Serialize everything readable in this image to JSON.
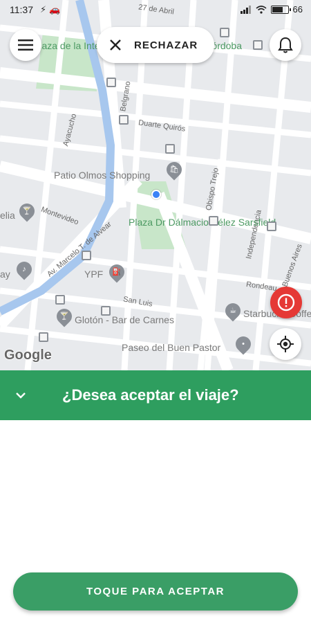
{
  "status_bar": {
    "time": "11:37",
    "battery_text": "66",
    "battery_level": 0.66
  },
  "top_controls": {
    "menu_icon": "menu-icon",
    "reject_label": "RECHAZAR",
    "reject_icon": "close-icon",
    "bell_icon": "bell-icon"
  },
  "map": {
    "labels": {
      "plaza_intendencia": "Plaza de la Intendencia de la ciudad de Córdoba",
      "abril": "27 de Abril",
      "belgrano": "Belgrano",
      "duarte_quiros": "Duarte Quirós",
      "ayacucho": "Ayacucho",
      "patio_olmos": "Patio Olmos Shopping",
      "obispo_trejo": "Obispo Trejo",
      "independencia": "Independencia",
      "montevideo": "Montevideo",
      "elia": "elia",
      "av_marcelo": "Av. Marcelo T. de Alvear",
      "plaza_velez": "Plaza Dr Dálmacio Vélez Sarsfield",
      "ypf": "YPF",
      "rondeau": "Rondeau",
      "buenos_aires": "Buenos Aires",
      "san_luis": "San Luis",
      "gloton": "Glotón - Bar de Carnes",
      "starbucks": "Starbucks Coffee",
      "paseo": "Paseo del Buen Pastor",
      "ay": "ay",
      "google": "Google"
    },
    "accent_blue": "#3b82f6"
  },
  "alert_icon": "alert-circle-icon",
  "locate_icon": "my-location-icon",
  "banner": {
    "question": "¿Desea aceptar el viaje?",
    "collapse_icon": "chevron-down-icon",
    "color": "#2e9e5f"
  },
  "accept": {
    "label": "TOQUE PARA ACEPTAR",
    "color": "#3a9e66"
  }
}
